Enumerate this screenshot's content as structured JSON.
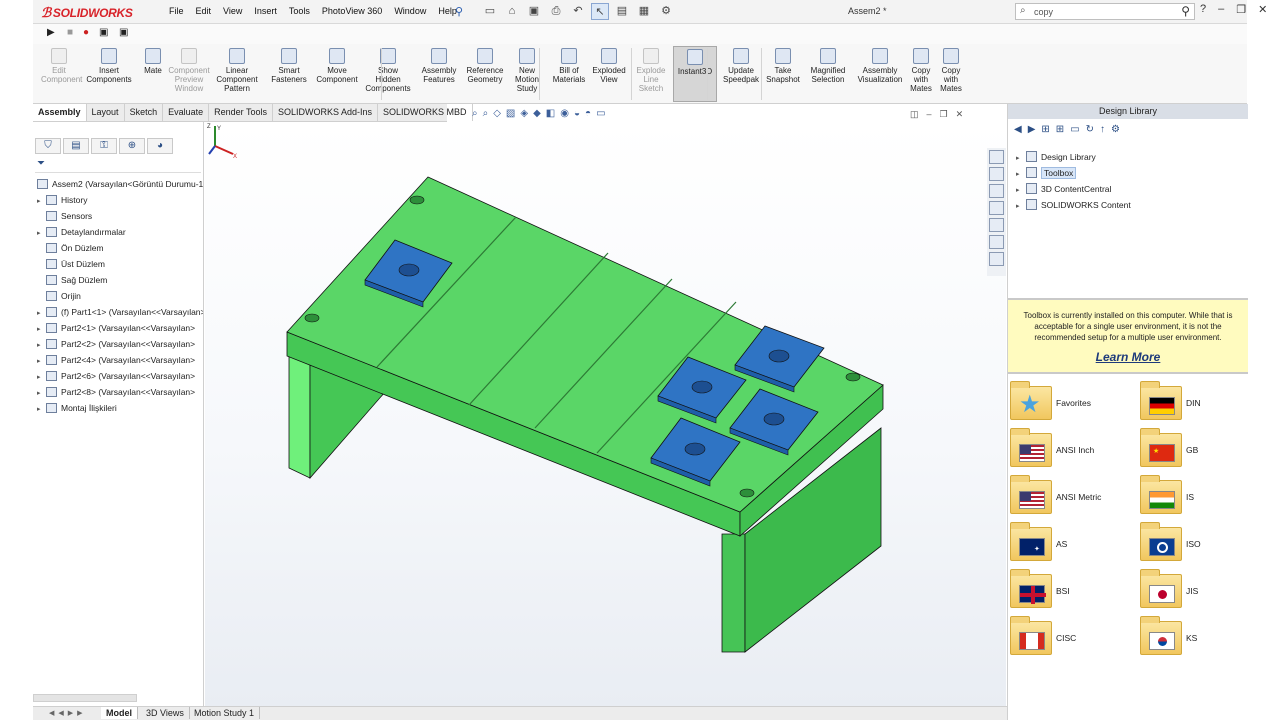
{
  "app": {
    "brand": "SOLIDWORKS",
    "document_title": "Assem2 *"
  },
  "menu": [
    "File",
    "Edit",
    "View",
    "Insert",
    "Tools",
    "PhotoView 360",
    "Window",
    "Help"
  ],
  "search": {
    "value": "copy"
  },
  "toolbar": {
    "commands": [
      {
        "label": "Edit\nComponent",
        "disabled": true
      },
      {
        "label": "Insert\nComponents",
        "disabled": false
      },
      {
        "label": "Mate",
        "disabled": false
      },
      {
        "label": "Component\nPreview\nWindow",
        "disabled": true
      },
      {
        "label": "Linear\nComponent\nPattern",
        "disabled": false
      },
      {
        "label": "Smart\nFasteners",
        "disabled": false
      },
      {
        "label": "Move\nComponent",
        "disabled": false
      },
      {
        "label": "Show\nHidden\nComponents",
        "disabled": false
      },
      {
        "label": "Assembly\nFeatures",
        "disabled": false
      },
      {
        "label": "Reference\nGeometry",
        "disabled": false
      },
      {
        "label": "New\nMotion\nStudy",
        "disabled": false
      },
      {
        "label": "Bill of\nMaterials",
        "disabled": false
      },
      {
        "label": "Exploded\nView",
        "disabled": false
      },
      {
        "label": "Explode\nLine\nSketch",
        "disabled": true
      },
      {
        "label": "Instant3D",
        "disabled": false,
        "active": true
      },
      {
        "label": "Update\nSpeedpak",
        "disabled": false
      },
      {
        "label": "Take\nSnapshot",
        "disabled": false
      },
      {
        "label": "Magnified\nSelection",
        "disabled": false
      },
      {
        "label": "Assembly\nVisualization",
        "disabled": false
      },
      {
        "label": "Copy\nwith\nMates",
        "disabled": false
      },
      {
        "label": "Copy\nwith\nMates",
        "disabled": false
      }
    ]
  },
  "tabs": [
    "Assembly",
    "Layout",
    "Sketch",
    "Evaluate",
    "Render Tools",
    "SOLIDWORKS Add-Ins",
    "SOLIDWORKS MBD"
  ],
  "feature_tree": {
    "root": "Assem2  (Varsayılan<Görüntü Durumu-1>",
    "items": [
      {
        "label": "History",
        "expandable": true
      },
      {
        "label": "Sensors",
        "expandable": false
      },
      {
        "label": "Detaylandırmalar",
        "expandable": true
      },
      {
        "label": "Ön Düzlem",
        "expandable": false
      },
      {
        "label": "Üst Düzlem",
        "expandable": false
      },
      {
        "label": "Sağ Düzlem",
        "expandable": false
      },
      {
        "label": "Orijin",
        "expandable": false
      },
      {
        "label": "(f) Part1<1> (Varsayılan<<Varsayılan>",
        "expandable": true
      },
      {
        "label": "Part2<1> (Varsayılan<<Varsayılan>",
        "expandable": true
      },
      {
        "label": "Part2<2> (Varsayılan<<Varsayılan>",
        "expandable": true
      },
      {
        "label": "Part2<4> (Varsayılan<<Varsayılan>",
        "expandable": true
      },
      {
        "label": "Part2<6> (Varsayılan<<Varsayılan>",
        "expandable": true
      },
      {
        "label": "Part2<8> (Varsayılan<<Varsayılan>",
        "expandable": true
      },
      {
        "label": "Montaj İlişkileri",
        "expandable": true
      }
    ]
  },
  "bottom_tabs": [
    "Model",
    "3D Views",
    "Motion Study 1"
  ],
  "design_library": {
    "title": "Design Library",
    "tree": [
      {
        "label": "Design Library",
        "selected": false
      },
      {
        "label": "Toolbox",
        "selected": true
      },
      {
        "label": "3D ContentCentral",
        "selected": false
      },
      {
        "label": "SOLIDWORKS Content",
        "selected": false
      }
    ],
    "notice": "Toolbox is currently installed on this computer. While that is acceptable for a single user environment, it is not the recommended setup for a multiple user environment.",
    "learn_more": "Learn More",
    "libraries": [
      {
        "name": "Favorites",
        "flag": "star"
      },
      {
        "name": "DIN",
        "flag": "de"
      },
      {
        "name": "ANSI Inch",
        "flag": "us"
      },
      {
        "name": "GB",
        "flag": "cn"
      },
      {
        "name": "ANSI Metric",
        "flag": "us"
      },
      {
        "name": "IS",
        "flag": "in"
      },
      {
        "name": "AS",
        "flag": "au"
      },
      {
        "name": "ISO",
        "flag": "iso"
      },
      {
        "name": "BSI",
        "flag": "gb"
      },
      {
        "name": "JIS",
        "flag": "jp"
      },
      {
        "name": "CISC",
        "flag": "ca"
      },
      {
        "name": "KS",
        "flag": "kr"
      }
    ]
  },
  "colors": {
    "part_green": "#4fd45f",
    "plate_blue": "#2f74c4",
    "accent_red": "#d8232a"
  }
}
